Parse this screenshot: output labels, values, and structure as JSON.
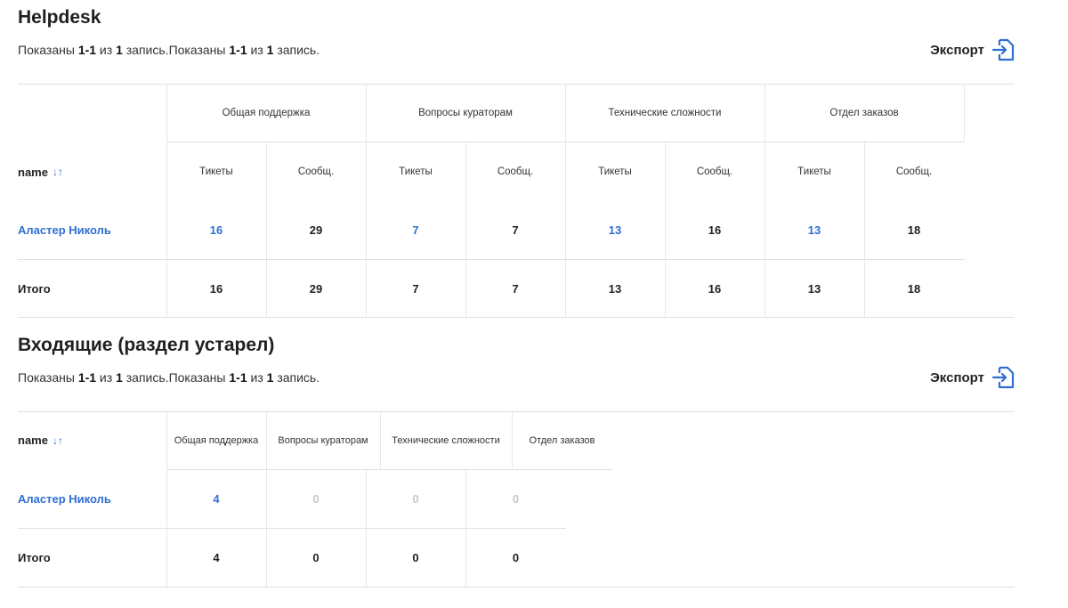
{
  "helpdesk": {
    "title": "Helpdesk",
    "summary": {
      "prefix": "Показаны ",
      "range": "1-1",
      "mid": " из ",
      "total": "1",
      "suffix": " запись.",
      "prefix2": "Показаны ",
      "range2": "1-1",
      "mid2": " из ",
      "total2": "1",
      "suffix2": " запись."
    },
    "export_label": "Экспорт",
    "groups": [
      "Общая поддержка",
      "Вопросы кураторам",
      "Технические сложности",
      "Отдел заказов"
    ],
    "sub_tickets": "Тикеты",
    "sub_messages": "Сообщ.",
    "name_header": "name",
    "sort_icon": "↓↑",
    "rows": [
      {
        "name": "Аластер Николь",
        "values": [
          "16",
          "29",
          "7",
          "7",
          "13",
          "16",
          "13",
          "18"
        ]
      }
    ],
    "total_row": {
      "name": "Итого",
      "values": [
        "16",
        "29",
        "7",
        "7",
        "13",
        "16",
        "13",
        "18"
      ]
    }
  },
  "incoming": {
    "title": "Входящие (раздел устарел)",
    "summary": {
      "prefix": "Показаны ",
      "range": "1-1",
      "mid": " из ",
      "total": "1",
      "suffix": " запись.",
      "prefix2": "Показаны ",
      "range2": "1-1",
      "mid2": " из ",
      "total2": "1",
      "suffix2": " запись."
    },
    "export_label": "Экспорт",
    "name_header": "name",
    "sort_icon": "↓↑",
    "columns": [
      "Общая поддержка",
      "Вопросы кураторам",
      "Технические сложности",
      "Отдел заказов"
    ],
    "rows": [
      {
        "name": "Аластер Николь",
        "values": [
          "4",
          "0",
          "0",
          "0"
        ]
      }
    ],
    "total_row": {
      "name": "Итого",
      "values": [
        "4",
        "0",
        "0",
        "0"
      ]
    }
  },
  "colors": {
    "accent": "#2f6fd1",
    "muted": "#c8c8c8",
    "border": "#e0e0e0"
  }
}
